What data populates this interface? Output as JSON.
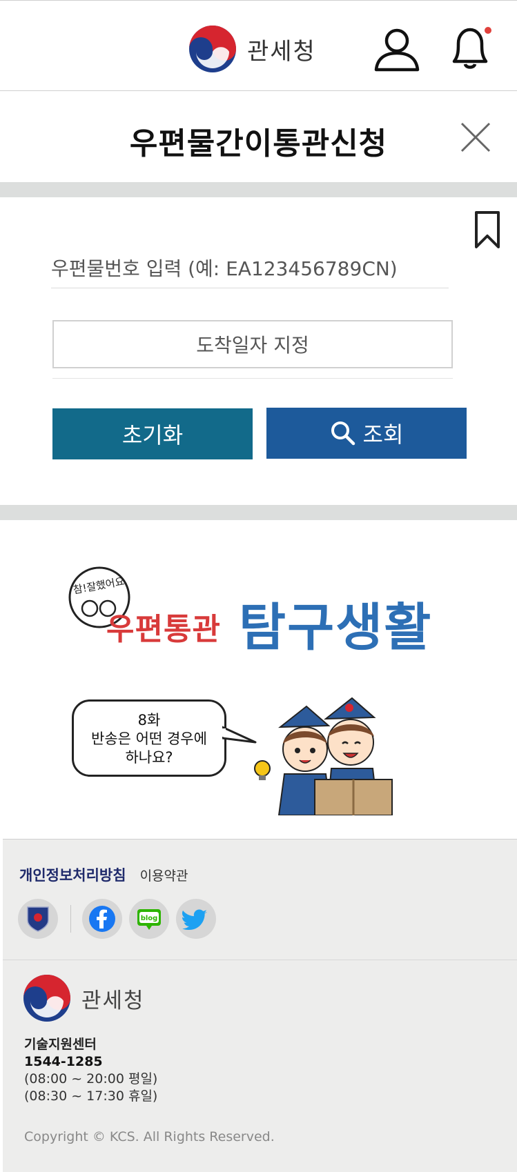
{
  "header": {
    "brand_name": "관세청",
    "notification_dot_color": "#e0413c"
  },
  "page": {
    "title": "우편물간이통관신청"
  },
  "form": {
    "postal_placeholder": "우편물번호 입력 (예: EA123456789CN)",
    "arrival_date_label": "도착일자 지정",
    "reset_label": "초기화",
    "search_label": "조회",
    "reset_color": "#126a8a",
    "search_color": "#1d5a9b"
  },
  "banner": {
    "badge_text": "참!잘했어요",
    "title_red": "우편통관",
    "title_blue": "탐구생활",
    "bubble_lines": [
      "8화",
      "반송은 어떤 경우에",
      "하나요?"
    ]
  },
  "footer": {
    "privacy_link": "개인정보처리방침",
    "terms_link": "이용약관",
    "social_icons": [
      "kcs-emblem-icon",
      "facebook-icon",
      "blog-icon",
      "twitter-icon"
    ],
    "blog_badge": "blog",
    "brand_name": "관세청",
    "support_title": "기술지원센터",
    "support_phone": "1544-1285",
    "weekday_hours": "(08:00 ~ 20:00 평일)",
    "holiday_hours": "(08:30 ~ 17:30 휴일)",
    "copyright": "Copyright © KCS. All Rights Reserved."
  }
}
